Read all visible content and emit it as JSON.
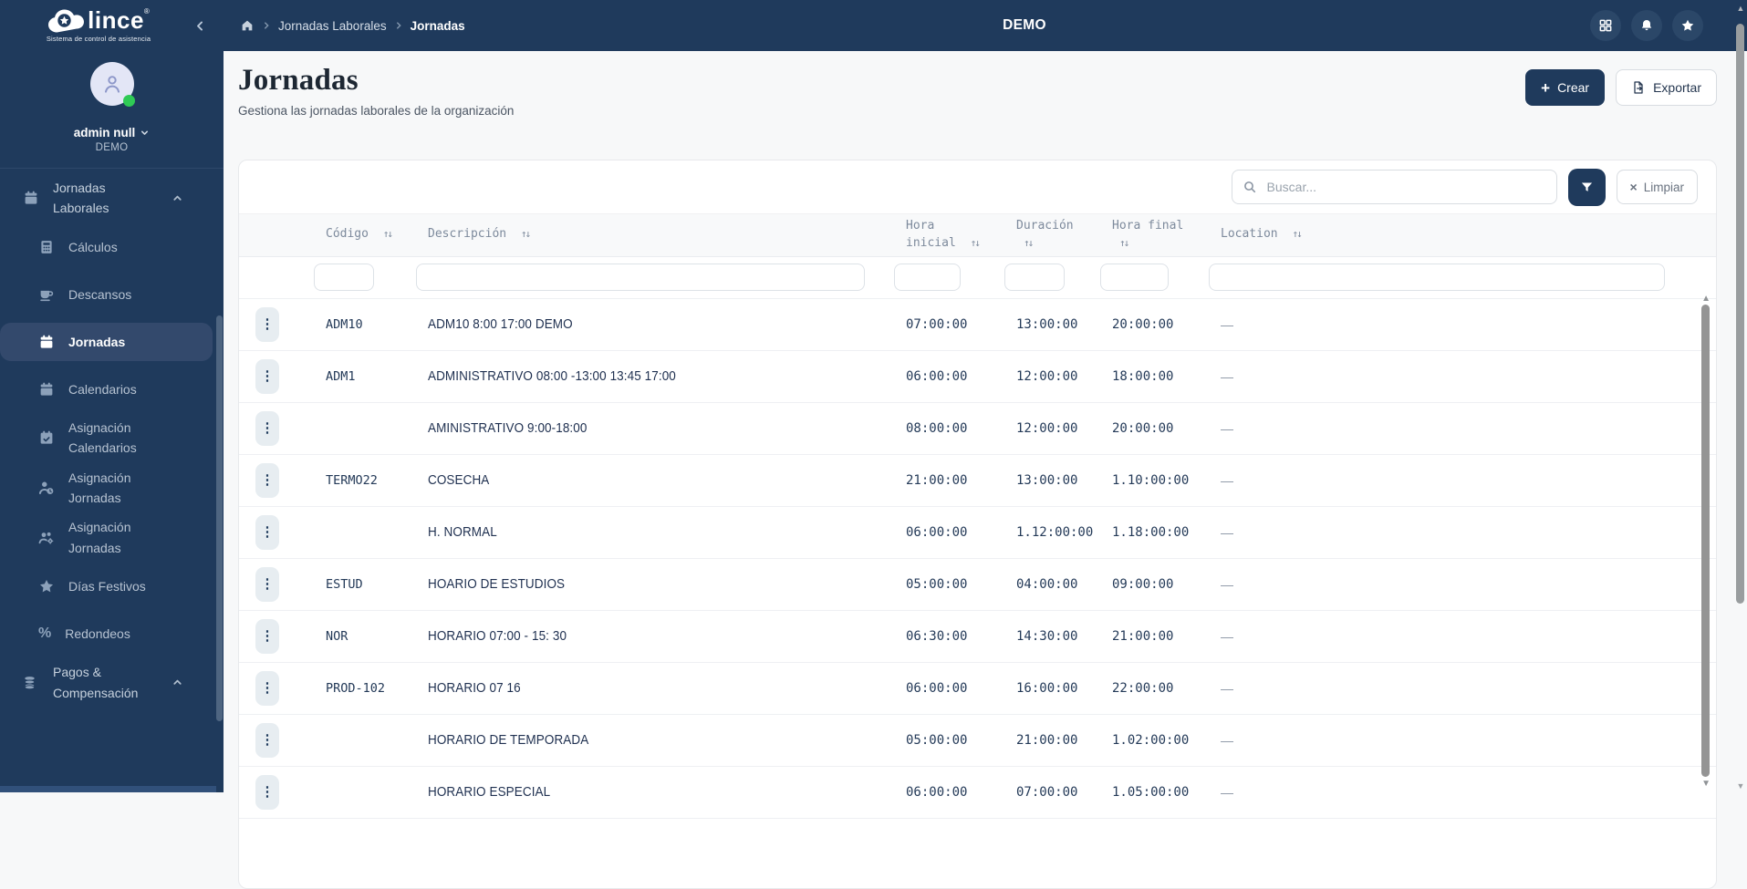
{
  "navbar": {
    "logo": {
      "brand": "lince",
      "registered": "®",
      "tagline": "Sistema de control de asistencia"
    },
    "breadcrumb": [
      "Jornadas Laborales",
      "Jornadas"
    ],
    "environment_title": "DEMO",
    "action_icons": [
      "grid",
      "bell",
      "star"
    ]
  },
  "sidebar": {
    "user": {
      "name": "admin null",
      "org": "DEMO",
      "status": "online"
    },
    "menu": [
      {
        "label": "Jornadas Laborales",
        "icon": "calendar",
        "level": 0,
        "chevron": "chevron-up",
        "active": false
      },
      {
        "label": "Cálculos",
        "icon": "calculator",
        "level": 1,
        "active": false
      },
      {
        "label": "Descansos",
        "icon": "coffee",
        "level": 1,
        "active": false
      },
      {
        "label": "Jornadas",
        "icon": "calendar",
        "level": 1,
        "active": true
      },
      {
        "label": "Calendarios",
        "icon": "calendar",
        "level": 1,
        "active": false
      },
      {
        "label": "Asignación Calendarios",
        "icon": "calendar-check",
        "level": 1,
        "active": false
      },
      {
        "label": "Asignación Jornadas",
        "icon": "user-clock",
        "level": 1,
        "active": false
      },
      {
        "label": "Asignación Jornadas",
        "icon": "users-gear",
        "level": 1,
        "active": false
      },
      {
        "label": "Días Festivos",
        "icon": "star",
        "level": 1,
        "active": false
      },
      {
        "label": "Redondeos",
        "icon": "percent",
        "level": 1,
        "active": false
      },
      {
        "label": "Pagos & Compensación",
        "icon": "coins",
        "level": 0,
        "chevron": "chevron-up",
        "active": false
      }
    ]
  },
  "page": {
    "title": "Jornadas",
    "subtitle": "Gestiona las jornadas laborales de la organización",
    "create_label": "Crear",
    "create_icon": "plus",
    "export_label": "Exportar",
    "export_icon": "export-doc"
  },
  "toolbar": {
    "search_placeholder": "Buscar...",
    "search_icon": "search",
    "filter_icon": "funnel",
    "clear_label": "Limpiar",
    "clear_icon": "x"
  },
  "table": {
    "columns": [
      "Código",
      "Descripción",
      "Hora inicial",
      "Duración",
      "Hora final",
      "Location"
    ],
    "sort_icon": "↑↓",
    "row_action_icon": "kebab",
    "empty_location": "—",
    "rows": [
      {
        "code": "ADM10",
        "description": "ADM10 8:00 17:00 DEMO",
        "start": "07:00:00",
        "duration": "13:00:00",
        "end": "20:00:00",
        "location": "—"
      },
      {
        "code": "ADM1",
        "description": "ADMINISTRATIVO 08:00 -13:00 13:45 17:00",
        "start": "06:00:00",
        "duration": "12:00:00",
        "end": "18:00:00",
        "location": "—"
      },
      {
        "code": "",
        "description": "AMINISTRATIVO 9:00-18:00",
        "start": "08:00:00",
        "duration": "12:00:00",
        "end": "20:00:00",
        "location": "—"
      },
      {
        "code": "TERMO22",
        "description": "COSECHA",
        "start": "21:00:00",
        "duration": "13:00:00",
        "end": "1.10:00:00",
        "location": "—"
      },
      {
        "code": "",
        "description": "H. NORMAL",
        "start": "06:00:00",
        "duration": "1.12:00:00",
        "end": "1.18:00:00",
        "location": "—"
      },
      {
        "code": "ESTUD",
        "description": "HOARIO DE ESTUDIOS",
        "start": "05:00:00",
        "duration": "04:00:00",
        "end": "09:00:00",
        "location": "—"
      },
      {
        "code": "NOR",
        "description": "HORARIO 07:00 - 15: 30",
        "start": "06:30:00",
        "duration": "14:30:00",
        "end": "21:00:00",
        "location": "—"
      },
      {
        "code": "PROD-102",
        "description": "HORARIO 07 16",
        "start": "06:00:00",
        "duration": "16:00:00",
        "end": "22:00:00",
        "location": "—"
      },
      {
        "code": "",
        "description": "HORARIO DE TEMPORADA",
        "start": "05:00:00",
        "duration": "21:00:00",
        "end": "1.02:00:00",
        "location": "—"
      },
      {
        "code": "",
        "description": "HORARIO ESPECIAL",
        "start": "06:00:00",
        "duration": "07:00:00",
        "end": "1.05:00:00",
        "location": "—"
      }
    ]
  },
  "colors": {
    "navy": "#1f3a5c",
    "active_item_bg": "#33496c",
    "nav_circle_bg": "#2b4768",
    "page_bg": "#f7f8f9",
    "card_bg": "#ffffff",
    "header_text": "#7d8a9c",
    "cell_text": "#243a58",
    "status_green": "#2fca55",
    "kebab_bg": "#e7edf1"
  }
}
